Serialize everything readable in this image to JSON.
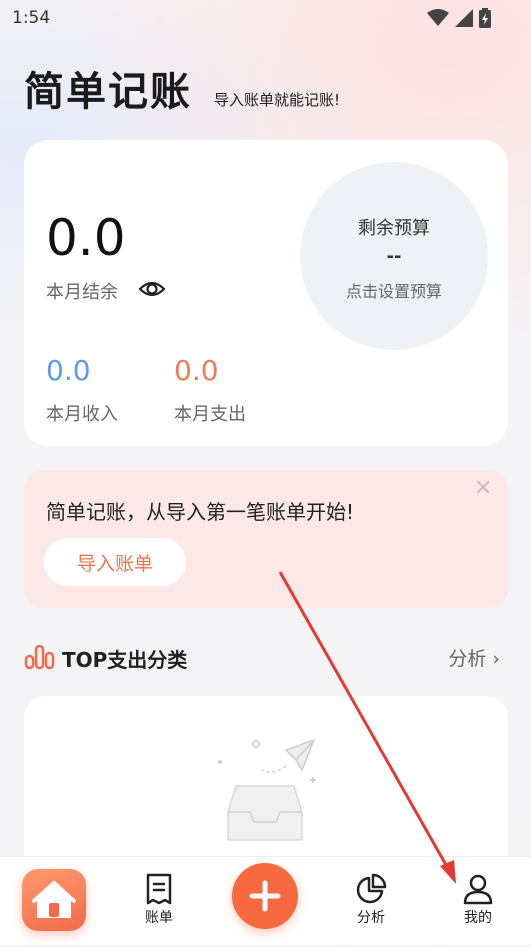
{
  "status_bar": {
    "time": "1:54"
  },
  "header": {
    "title": "简单记账",
    "subtitle": "导入账单就能记账!"
  },
  "summary": {
    "balance_value": "0.0",
    "balance_label": "本月结余",
    "income_value": "0.0",
    "income_label": "本月收入",
    "expense_value": "0.0",
    "expense_label": "本月支出",
    "budget_title": "剩余预算",
    "budget_value": "--",
    "budget_hint": "点击设置预算"
  },
  "import_banner": {
    "text": "简单记账，从导入第一笔账单开始!",
    "button_label": "导入账单"
  },
  "top_expense": {
    "title": "TOP支出分类",
    "link_label": "分析 ›"
  },
  "bottom_nav": {
    "items": [
      {
        "label": "",
        "icon": "home-icon"
      },
      {
        "label": "账单",
        "icon": "bill-icon"
      },
      {
        "label": "",
        "icon": "plus-icon"
      },
      {
        "label": "分析",
        "icon": "pie-chart-icon"
      },
      {
        "label": "我的",
        "icon": "user-icon"
      }
    ]
  },
  "colors": {
    "accent": "#f7693f",
    "income": "#5b9cf2",
    "expense": "#f47a54",
    "banner_bg": "#fde8e8"
  }
}
